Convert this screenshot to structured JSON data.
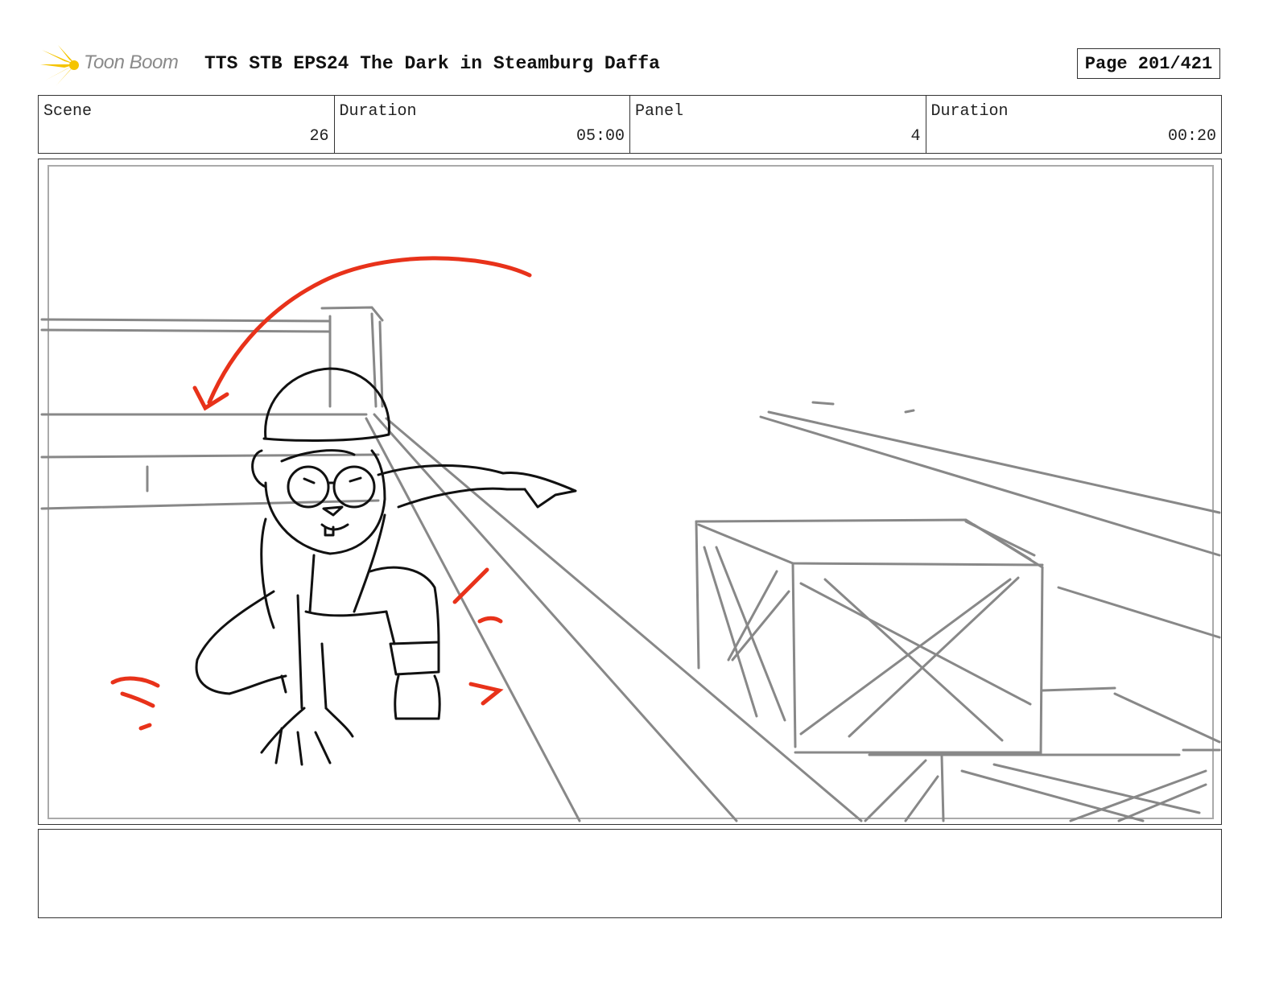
{
  "header": {
    "logo_text": "Toon Boom",
    "title": "TTS STB EPS24 The Dark in Steamburg Daffa",
    "page": "Page 201/421"
  },
  "info": [
    {
      "label": "Scene",
      "value": "26"
    },
    {
      "label": "Duration",
      "value": "05:00"
    },
    {
      "label": "Panel",
      "value": "4"
    },
    {
      "label": "Duration",
      "value": "00:20"
    }
  ],
  "colors": {
    "logo_yellow": "#f5c400",
    "sketch_red": "#e8321a",
    "sketch_black": "#111111",
    "sketch_gray": "#888888"
  }
}
